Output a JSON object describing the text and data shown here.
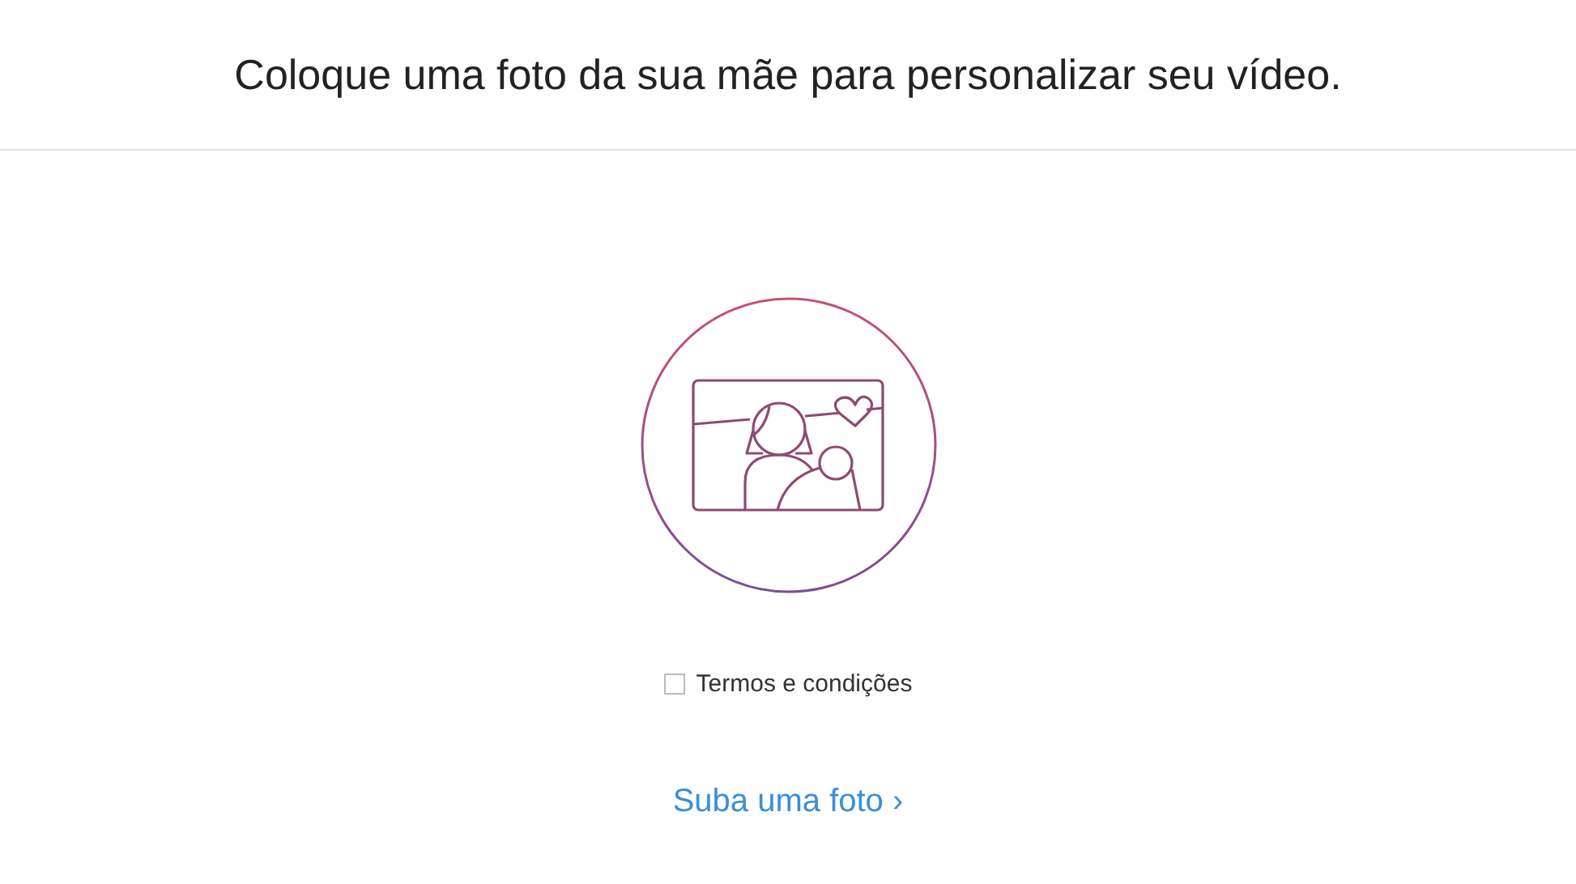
{
  "header": {
    "title": "Coloque uma foto da sua mãe para personalizar seu vídeo."
  },
  "terms": {
    "label": "Termos e condições",
    "checked": false
  },
  "upload_link": {
    "label": "Suba uma foto ›"
  }
}
